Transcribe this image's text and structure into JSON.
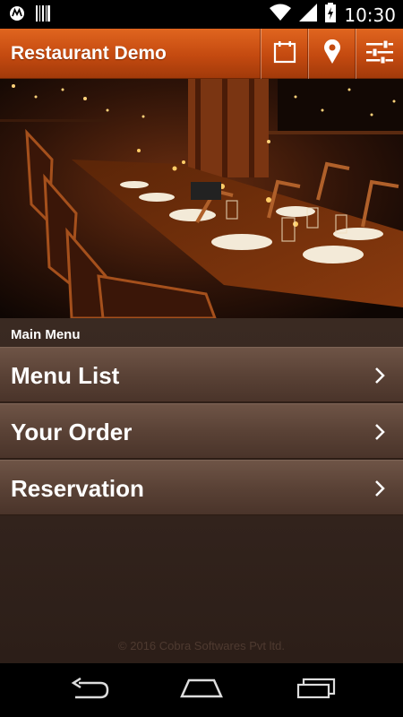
{
  "status_bar": {
    "time": "10:30"
  },
  "app_bar": {
    "title": "Restaurant Demo",
    "actions": [
      "calendar-icon",
      "location-pin-icon",
      "sliders-icon"
    ]
  },
  "main_menu": {
    "section_title": "Main Menu",
    "items": [
      {
        "label": "Menu List"
      },
      {
        "label": "Your Order"
      },
      {
        "label": "Reservation"
      }
    ]
  },
  "footer": {
    "copyright": "© 2016 Cobra Softwares Pvt ltd."
  },
  "colors": {
    "app_bar": "#c44a10",
    "menu_row": "#5a4236",
    "background": "#2c1e18"
  }
}
